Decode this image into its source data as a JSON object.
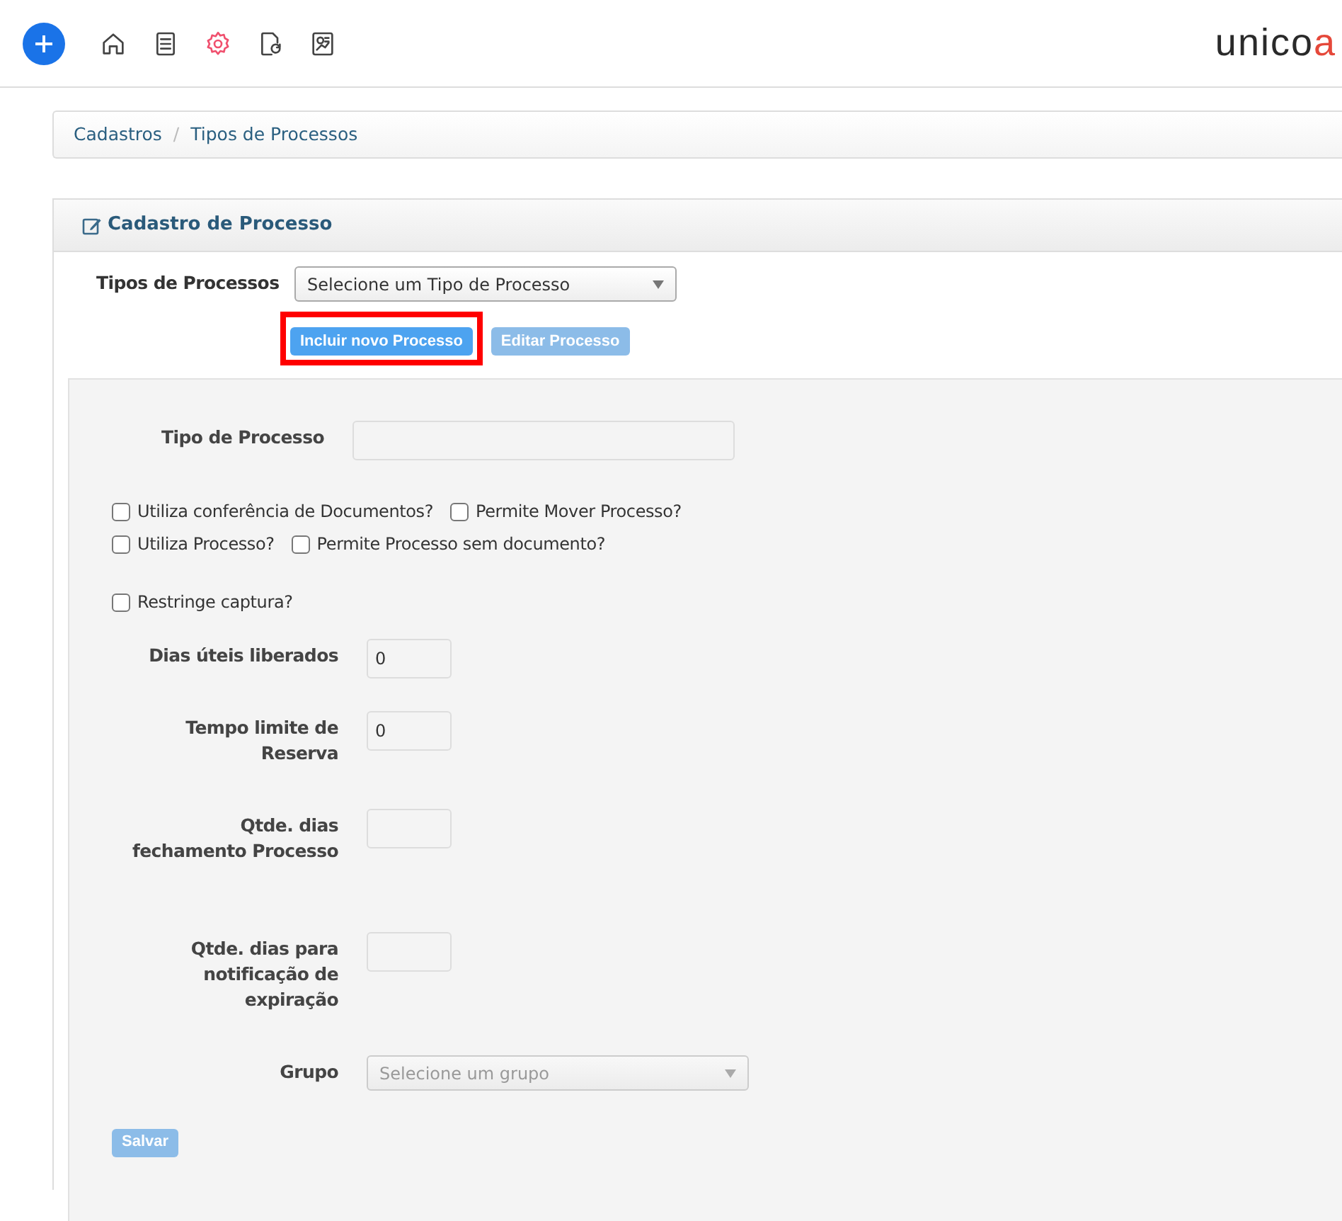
{
  "toolbar": {
    "icons": [
      {
        "kind": "home",
        "selected": false
      },
      {
        "kind": "document",
        "selected": false
      },
      {
        "kind": "gear",
        "selected": true
      },
      {
        "kind": "refresh-file",
        "selected": false
      },
      {
        "kind": "image-file",
        "selected": false
      }
    ]
  },
  "logo": {
    "main": "unico",
    "accent": "a"
  },
  "breadcrumb": {
    "separator": "/",
    "items": [
      "Cadastros",
      "Tipos de Processos"
    ]
  },
  "panel": {
    "title": "Cadastro de Processo",
    "type_select": {
      "label": "Tipos de Processos",
      "value": "Selecione um Tipo de Processo"
    },
    "buttons": [
      {
        "label": "Incluir novo Processo",
        "disabled": false,
        "highlighted": true
      },
      {
        "label": "Editar Processo",
        "disabled": true,
        "highlighted": false
      }
    ],
    "form": {
      "fields_top": [
        {
          "kind": "text",
          "label": "Tipo de Processo"
        }
      ],
      "checkbox_rows": [
        [
          {
            "label": "Utiliza conferência de Documentos?",
            "checked": false
          },
          {
            "label": "Permite Mover Processo?",
            "checked": false
          }
        ],
        [
          {
            "label": "Utiliza Processo?",
            "checked": false
          },
          {
            "label": "Permite Processo sem documento?",
            "checked": false
          }
        ],
        [
          {
            "label": "Restringe captura?",
            "checked": false
          }
        ]
      ],
      "fields": [
        {
          "kind": "number",
          "label": "Dias úteis liberados",
          "value": "0"
        },
        {
          "kind": "number",
          "label": "Tempo limite de Reserva",
          "value": "0"
        },
        {
          "kind": "number",
          "label": "Qtde. dias fechamento Processo"
        },
        {
          "kind": "number",
          "label": "Qtde. dias para notificação de expiração"
        },
        {
          "kind": "select",
          "label": "Grupo",
          "placeholder": "Selecione um grupo"
        }
      ],
      "save": {
        "label": "Salvar",
        "disabled": true
      }
    }
  }
}
